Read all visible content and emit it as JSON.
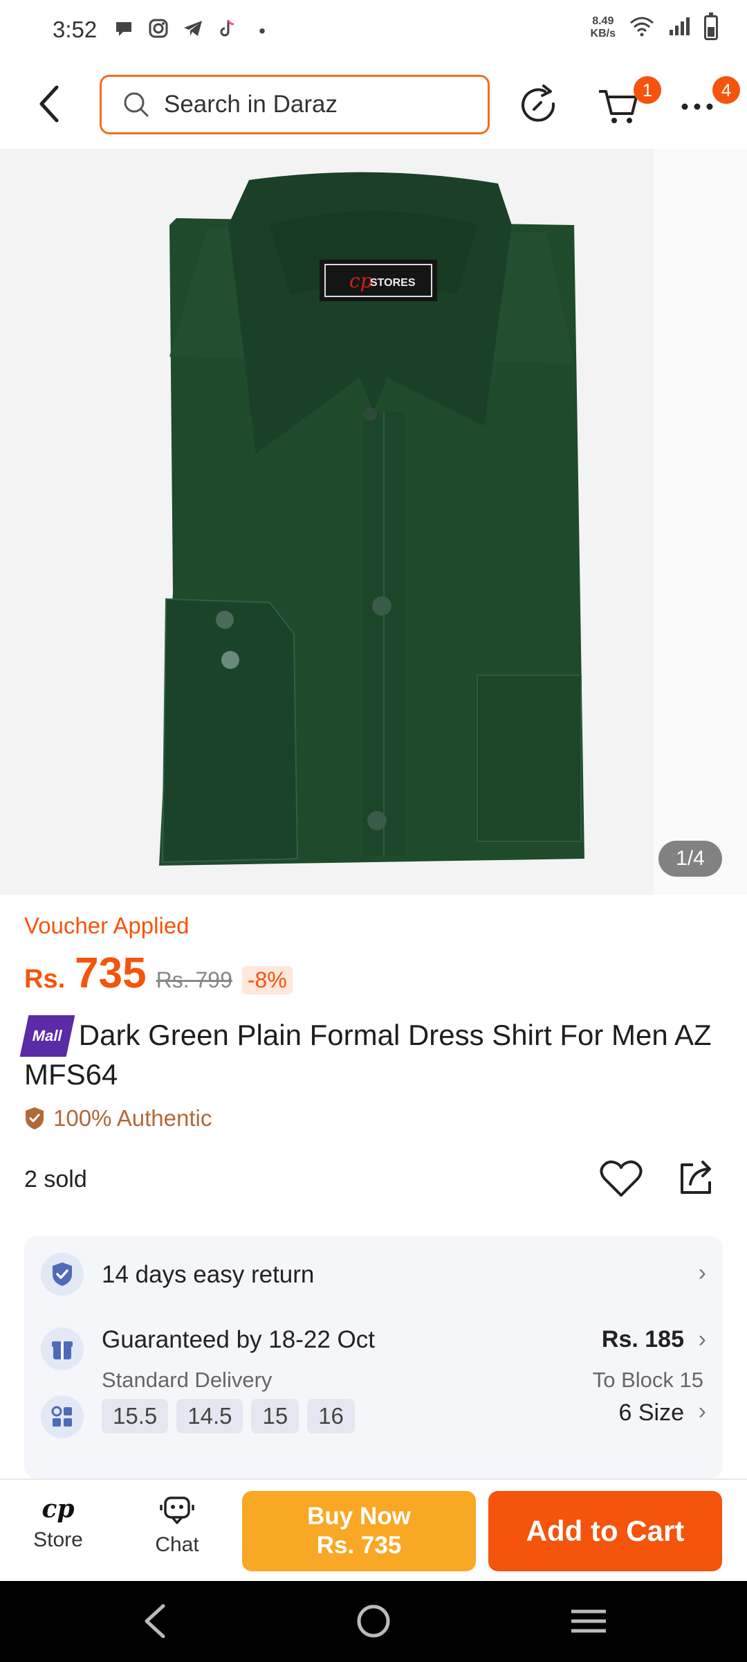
{
  "status_bar": {
    "time": "3:52",
    "net_speed_value": "8.49",
    "net_speed_unit": "KB/s",
    "dot": "•"
  },
  "header": {
    "search_placeholder": "Search in Daraz",
    "cart_badge": "1",
    "more_badge": "4"
  },
  "gallery": {
    "counter": "1/4",
    "label_brand": "cp",
    "label_text": "STORES"
  },
  "product": {
    "voucher": "Voucher Applied",
    "currency": "Rs.",
    "price": "735",
    "old_price": "Rs. 799",
    "discount": "-8%",
    "mall_badge": "Mall",
    "title": "Dark Green Plain Formal Dress Shirt For Men AZ MFS64",
    "authentic": "100% Authentic",
    "sold": "2 sold"
  },
  "services": {
    "return_text": "14 days easy return",
    "delivery_title": "Guaranteed by 18-22 Oct",
    "delivery_type": "Standard Delivery",
    "delivery_fee": "Rs. 185",
    "delivery_to": "To Block 15",
    "sizes": [
      "15.5",
      "14.5",
      "15",
      "16"
    ],
    "size_count": "6 Size"
  },
  "action_bar": {
    "store_logo": "cp",
    "store_label": "Store",
    "chat_label": "Chat",
    "buy_now_line1": "Buy Now",
    "buy_now_line2": "Rs. 735",
    "add_to_cart": "Add to Cart"
  },
  "colors": {
    "brand_orange": "#f5540d",
    "buy_now_yellow": "#f9a825",
    "mall_purple": "#5b2aa6",
    "shirt_green": "#1f4a2c"
  }
}
